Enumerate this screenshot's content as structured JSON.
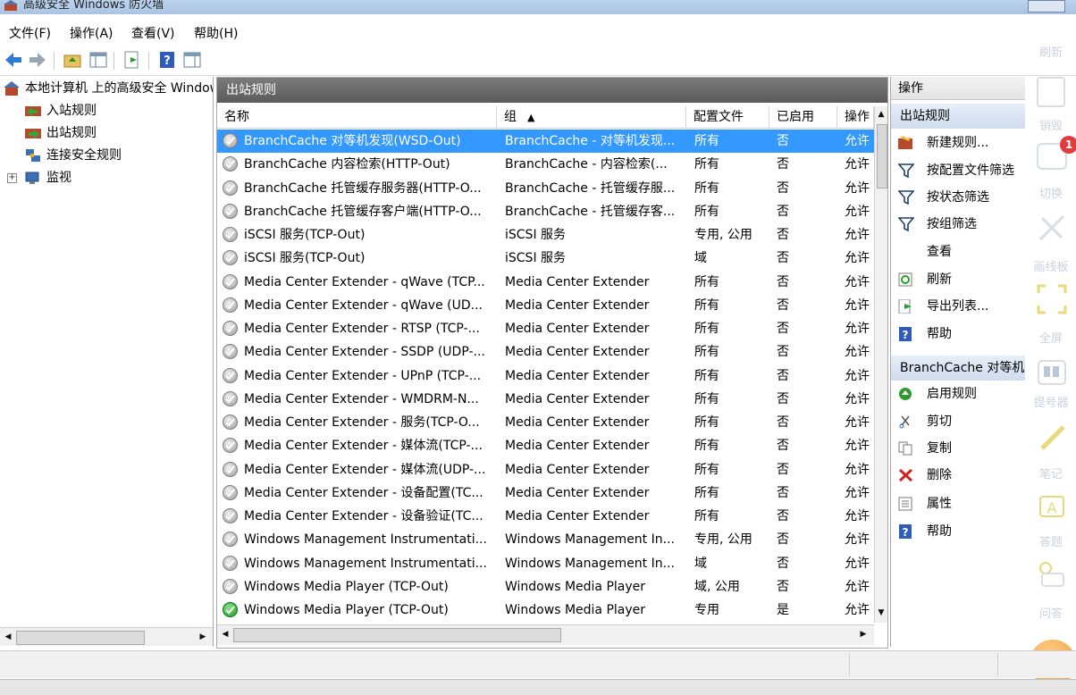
{
  "window": {
    "title": "高级安全 Windows 防火墙"
  },
  "menu": [
    "文件(F)",
    "操作(A)",
    "查看(V)",
    "帮助(H)"
  ],
  "tree": {
    "root": "本地计算机 上的高级安全 Windows 防火墙",
    "items": [
      "入站规则",
      "出站规则",
      "连接安全规则",
      "监视"
    ]
  },
  "center": {
    "title": "出站规则",
    "columns": [
      "名称",
      "组",
      "配置文件",
      "已启用",
      "操作"
    ],
    "rows": [
      {
        "name": "BranchCache 对等机发现(WSD-Out)",
        "group": "BranchCache - 对等机发现...",
        "profile": "所有",
        "enabled": "否",
        "action": "允许",
        "state": "off"
      },
      {
        "name": "BranchCache 内容检索(HTTP-Out)",
        "group": "BranchCache - 内容检索(...",
        "profile": "所有",
        "enabled": "否",
        "action": "允许",
        "state": "off"
      },
      {
        "name": "BranchCache 托管缓存服务器(HTTP-O...",
        "group": "BranchCache - 托管缓存服...",
        "profile": "所有",
        "enabled": "否",
        "action": "允许",
        "state": "off"
      },
      {
        "name": "BranchCache 托管缓存客户端(HTTP-O...",
        "group": "BranchCache - 托管缓存客...",
        "profile": "所有",
        "enabled": "否",
        "action": "允许",
        "state": "off"
      },
      {
        "name": "iSCSI 服务(TCP-Out)",
        "group": "iSCSI 服务",
        "profile": "专用, 公用",
        "enabled": "否",
        "action": "允许",
        "state": "off"
      },
      {
        "name": "iSCSI 服务(TCP-Out)",
        "group": "iSCSI 服务",
        "profile": "域",
        "enabled": "否",
        "action": "允许",
        "state": "off"
      },
      {
        "name": "Media Center Extender - qWave (TCP...",
        "group": "Media Center Extender",
        "profile": "所有",
        "enabled": "否",
        "action": "允许",
        "state": "off"
      },
      {
        "name": "Media Center Extender - qWave (UD...",
        "group": "Media Center Extender",
        "profile": "所有",
        "enabled": "否",
        "action": "允许",
        "state": "off"
      },
      {
        "name": "Media Center Extender - RTSP (TCP-...",
        "group": "Media Center Extender",
        "profile": "所有",
        "enabled": "否",
        "action": "允许",
        "state": "off"
      },
      {
        "name": "Media Center Extender - SSDP (UDP-...",
        "group": "Media Center Extender",
        "profile": "所有",
        "enabled": "否",
        "action": "允许",
        "state": "off"
      },
      {
        "name": "Media Center Extender - UPnP (TCP-...",
        "group": "Media Center Extender",
        "profile": "所有",
        "enabled": "否",
        "action": "允许",
        "state": "off"
      },
      {
        "name": "Media Center Extender - WMDRM-N...",
        "group": "Media Center Extender",
        "profile": "所有",
        "enabled": "否",
        "action": "允许",
        "state": "off"
      },
      {
        "name": "Media Center Extender - 服务(TCP-O...",
        "group": "Media Center Extender",
        "profile": "所有",
        "enabled": "否",
        "action": "允许",
        "state": "off"
      },
      {
        "name": "Media Center Extender - 媒体流(TCP-...",
        "group": "Media Center Extender",
        "profile": "所有",
        "enabled": "否",
        "action": "允许",
        "state": "off"
      },
      {
        "name": "Media Center Extender - 媒体流(UDP-...",
        "group": "Media Center Extender",
        "profile": "所有",
        "enabled": "否",
        "action": "允许",
        "state": "off"
      },
      {
        "name": "Media Center Extender - 设备配置(TC...",
        "group": "Media Center Extender",
        "profile": "所有",
        "enabled": "否",
        "action": "允许",
        "state": "off"
      },
      {
        "name": "Media Center Extender - 设备验证(TC...",
        "group": "Media Center Extender",
        "profile": "所有",
        "enabled": "否",
        "action": "允许",
        "state": "off"
      },
      {
        "name": "Windows Management Instrumentati...",
        "group": "Windows Management In...",
        "profile": "专用, 公用",
        "enabled": "否",
        "action": "允许",
        "state": "off"
      },
      {
        "name": "Windows Management Instrumentati...",
        "group": "Windows Management In...",
        "profile": "域",
        "enabled": "否",
        "action": "允许",
        "state": "off"
      },
      {
        "name": "Windows Media Player (TCP-Out)",
        "group": "Windows Media Player",
        "profile": "域, 公用",
        "enabled": "否",
        "action": "允许",
        "state": "off"
      },
      {
        "name": "Windows Media Player (TCP-Out)",
        "group": "Windows Media Player",
        "profile": "专用",
        "enabled": "是",
        "action": "允许",
        "state": "on"
      }
    ]
  },
  "actions": {
    "title": "操作",
    "section1": "出站规则",
    "section1_items": [
      "新建规则...",
      "按配置文件筛选",
      "按状态筛选",
      "按组筛选",
      "查看",
      "刷新",
      "导出列表...",
      "帮助"
    ],
    "section2": "BranchCache 对等机发现(WSD-Out)",
    "section2_items": [
      "启用规则",
      "剪切",
      "复制",
      "删除",
      "属性",
      "帮助"
    ]
  },
  "sidebar": {
    "items": [
      "刷新",
      "销毁",
      "切换",
      "画线板",
      "全屏",
      "提号器",
      "笔记",
      "答题",
      "问答"
    ],
    "badge": "1"
  }
}
